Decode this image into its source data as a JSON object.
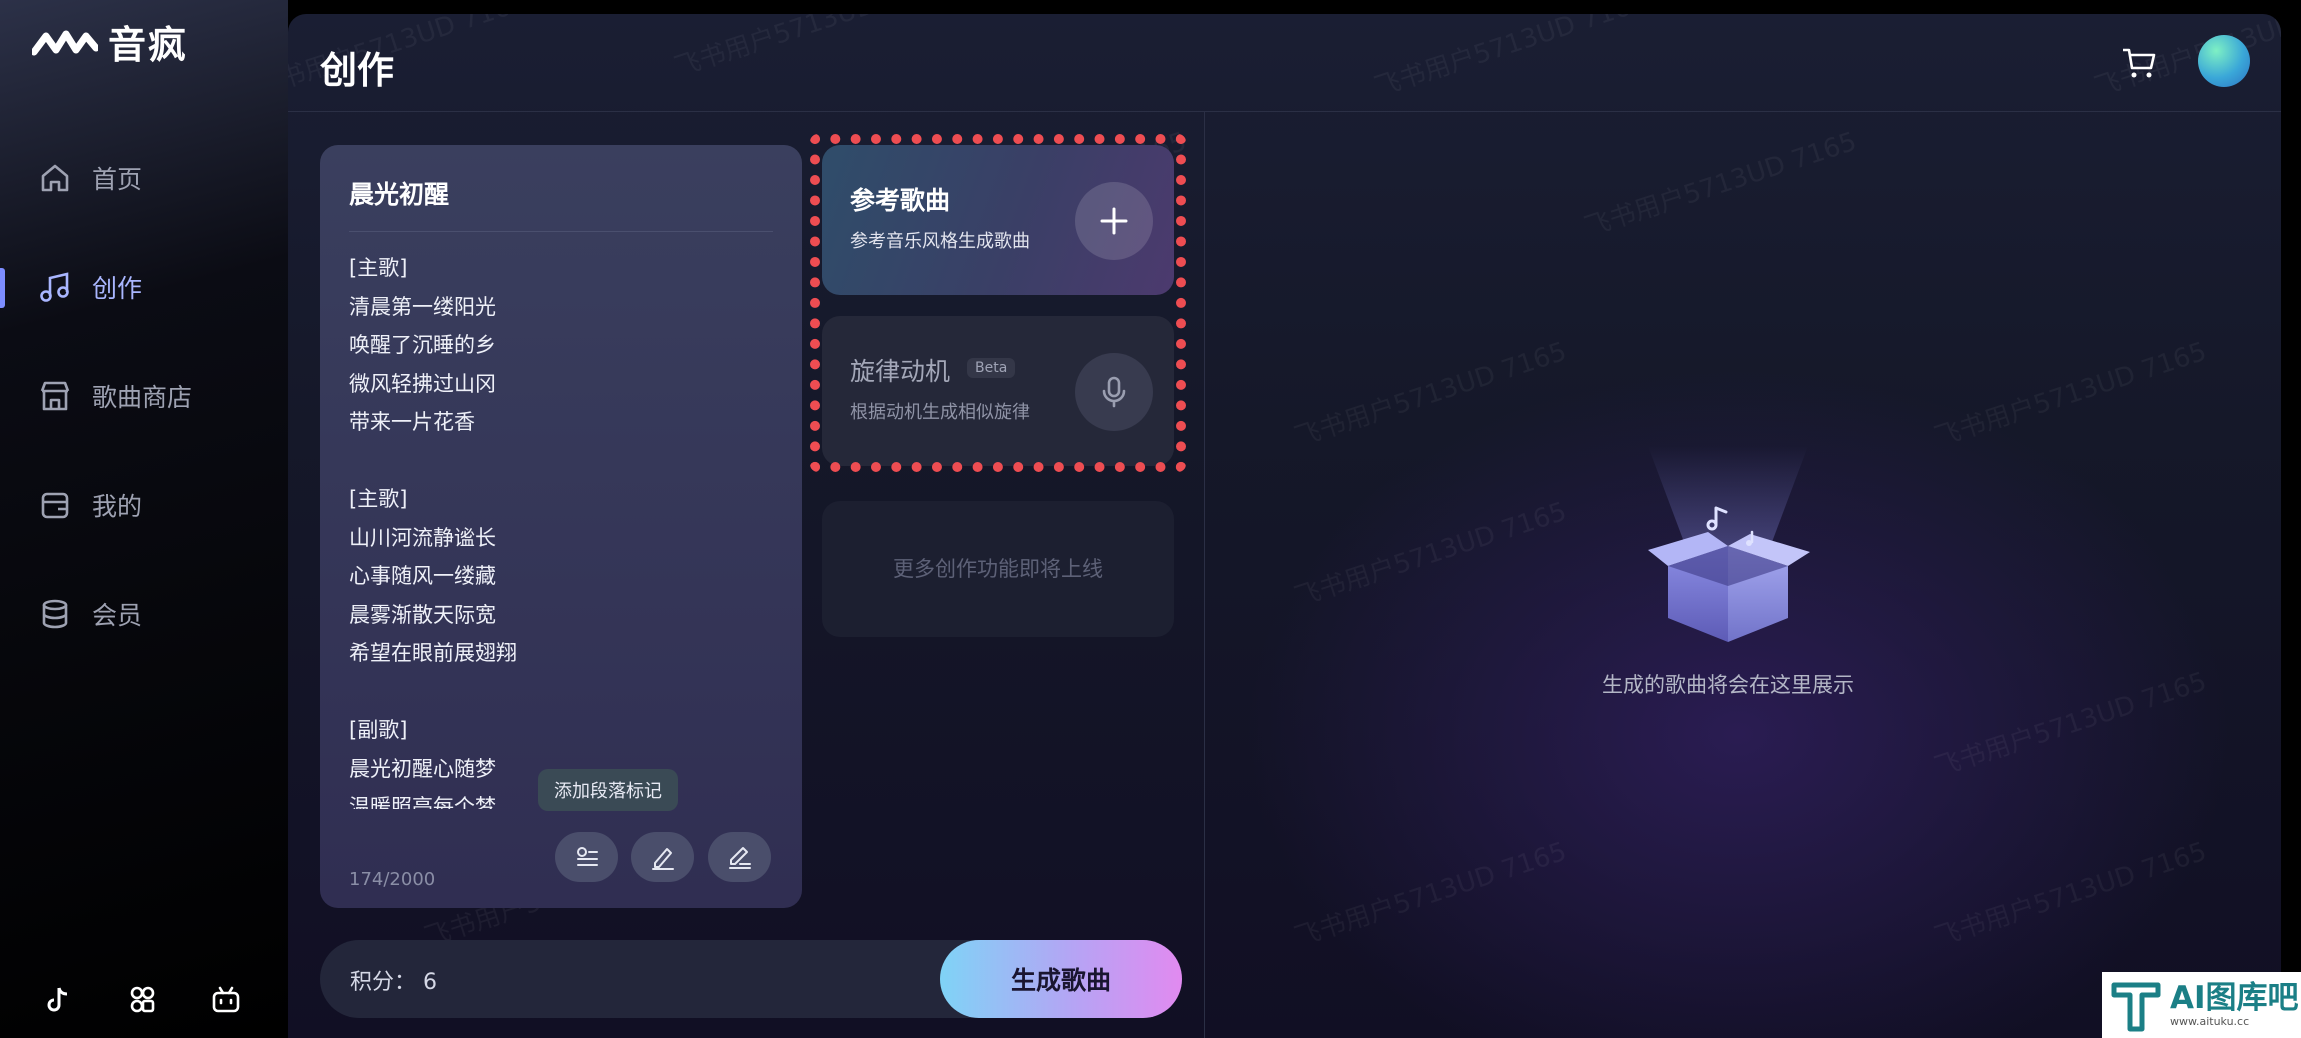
{
  "app": {
    "name": "音疯",
    "accent": "#a9b6ff"
  },
  "sidebar": {
    "items": [
      {
        "label": "首页",
        "icon": "home-icon"
      },
      {
        "label": "创作",
        "icon": "music-note-icon",
        "active": true
      },
      {
        "label": "歌曲商店",
        "icon": "store-icon"
      },
      {
        "label": "我的",
        "icon": "wallet-icon"
      },
      {
        "label": "会员",
        "icon": "database-icon"
      }
    ],
    "footer_icons": [
      "tiktok-icon",
      "community-icon",
      "bilibili-icon"
    ]
  },
  "header": {
    "title": "创作",
    "cart_icon": "cart-icon"
  },
  "lyrics": {
    "title": "晨光初醒",
    "lines": [
      "[主歌]",
      "清晨第一缕阳光",
      "唤醒了沉睡的乡",
      "微风轻拂过山冈",
      "带来一片花香",
      "",
      "[主歌]",
      "山川河流静谧长",
      "心事随风一缕藏",
      "晨雾渐散天际宽",
      "希望在眼前展翅翔",
      "",
      "[副歌]",
      "晨光初醒心随梦",
      "温暖照亮每个梦"
    ],
    "counter": "174/2000",
    "tooltip": "添加段落标记"
  },
  "features": {
    "reference": {
      "title": "参考歌曲",
      "subtitle": "参考音乐风格生成歌曲"
    },
    "motif": {
      "title": "旋律动机",
      "badge": "Beta",
      "subtitle": "根据动机生成相似旋律"
    },
    "more": "更多创作功能即将上线"
  },
  "bottom": {
    "points_label": "积分： 6",
    "generate_label": "生成歌曲"
  },
  "empty_state": {
    "text": "生成的歌曲将会在这里展示"
  },
  "watermark": {
    "text": "飞书用户5713UD 7165"
  },
  "corner_logo": {
    "main": "AI图库吧",
    "sub": "www.aituku.cc"
  }
}
